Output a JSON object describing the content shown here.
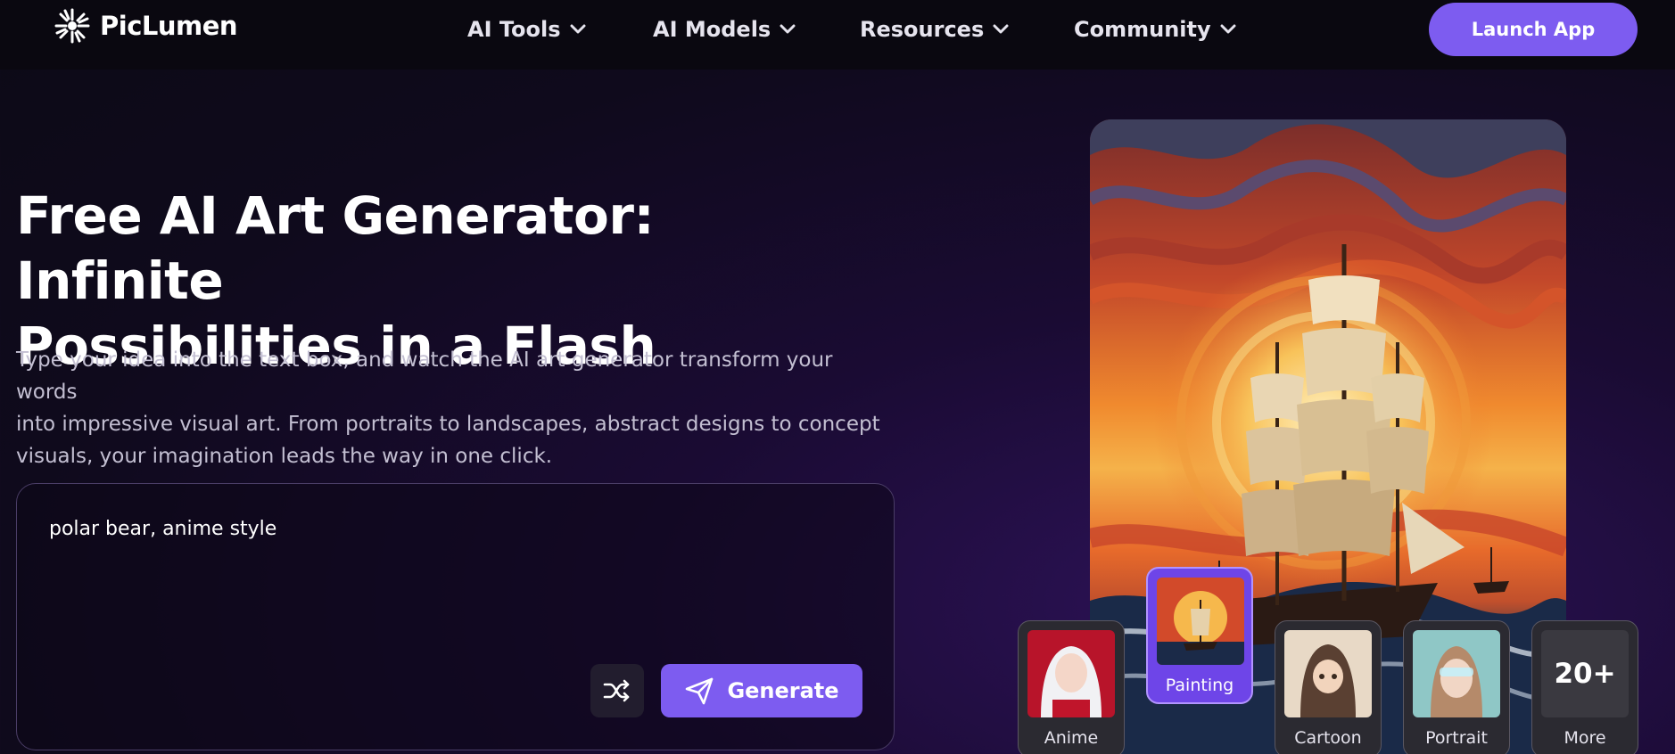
{
  "brand": {
    "name": "PicLumen"
  },
  "nav": {
    "items": [
      {
        "label": "AI Tools"
      },
      {
        "label": "AI Models"
      },
      {
        "label": "Resources"
      },
      {
        "label": "Community"
      }
    ],
    "launch_label": "Launch App"
  },
  "hero": {
    "title_line1": "Free AI Art Generator: Infinite",
    "title_line2": "Possibilities in a Flash",
    "desc_line1": "Type your idea into the text box, and watch the AI art generator transform your words",
    "desc_line2": "into impressive visual art. From portraits to landscapes, abstract designs to concept",
    "desc_line3": "visuals, your imagination leads the way in one click."
  },
  "prompt": {
    "value": "polar bear, anime style",
    "generate_label": "Generate"
  },
  "styles": [
    {
      "label": "Anime"
    },
    {
      "label": "Painting",
      "selected": true
    },
    {
      "label": "Cartoon"
    },
    {
      "label": "Portrait"
    },
    {
      "label": "More",
      "badge": "20+"
    }
  ],
  "colors": {
    "accent": "#7d5cf0",
    "nav_bg": "#0a0810",
    "page_bg": "#0f0a1c"
  }
}
